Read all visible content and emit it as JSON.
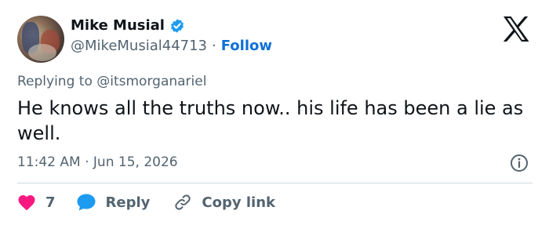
{
  "author": {
    "display_name": "Mike Musial",
    "handle": "@MikeMusial44713",
    "separator": "·",
    "follow_label": "Follow"
  },
  "icons": {
    "verified": "verified-badge-icon",
    "platform_logo": "x-logo-icon",
    "info": "info-icon",
    "like": "heart-icon",
    "reply": "speech-bubble-icon",
    "copy_link": "link-icon"
  },
  "tweet": {
    "replying_prefix": "Replying to",
    "replying_to": "@itsmorganariel",
    "text": "He knows all the truths now.. his life has been a lie as well.",
    "time": "11:42 AM",
    "date_separator": "·",
    "date": "Jun 15, 2026"
  },
  "actions": {
    "like_count": "7",
    "reply_label": "Reply",
    "copy_link_label": "Copy link"
  },
  "colors": {
    "link_blue": "#0f6fd6",
    "verified_blue": "#1d9bf0",
    "like_red": "#f91880",
    "muted_text": "#536471",
    "divider": "#cfd9de"
  }
}
